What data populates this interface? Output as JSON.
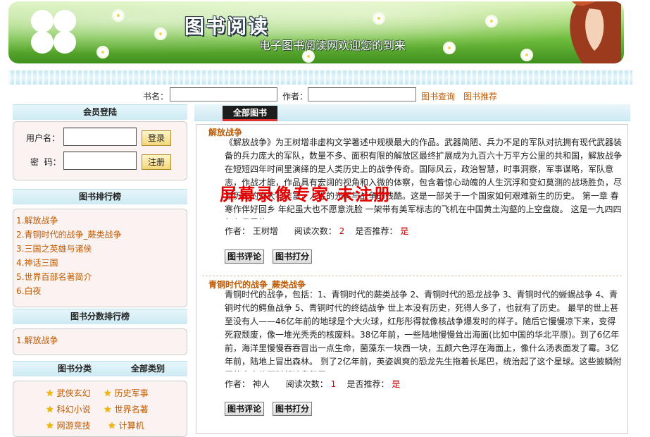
{
  "banner": {
    "title": "图书阅读",
    "subtitle": "电子图书阅读网欢迎您的到来"
  },
  "search": {
    "book_label": "书名：",
    "book_value": "",
    "author_label": "作者：",
    "author_value": "",
    "query_link": "图书查询",
    "recommend_link": "图书推荐"
  },
  "login": {
    "header": "会员登陆",
    "username_label": "用户名：",
    "password_label": "密  码：",
    "username_value": "",
    "password_value": "",
    "login_button": "登录",
    "register_button": "注册"
  },
  "ranking": {
    "header": "图书排行榜",
    "items": [
      "1.解放战争",
      "2.青铜时代的战争_蕨类战争",
      "3.三国之英雄与诸侯",
      "4.神话三国",
      "5.世界百部名著简介",
      "6.白夜"
    ]
  },
  "score_ranking": {
    "header": "图书分数排行榜",
    "items": [
      "1.解放战争"
    ]
  },
  "categories": {
    "header_left": "图书分类",
    "header_right": "全部类别",
    "items": [
      "武侠玄幻",
      "历史军事",
      "科幻小说",
      "世界名著",
      "网游竞技",
      "计算机"
    ]
  },
  "main": {
    "tab": "全部图书",
    "books": [
      {
        "title": "解放战争",
        "description": "《解放战争》为王树增非虚构文学著述中规模最大的作品。武器简陋、兵力不足的军队对抗拥有现代武器装备的兵力庞大的军队，数量不多、面积有限的解放区最终扩展成为九百六十万平方公里的共和国，解放战争在短短四年时间里演绎的是人类历史上的战争传奇。国际风云，政治智慧，时事洞察，军事谋略，军队意志，作战才能，作品具有宏阔的视角和入微的体察，包含着惊心动魄的人生沉浮和变幻莫测的战场胜负，尽显历史的宏大与丰富，人性的光辉与战争的残酷。这是一部关于一个国家如何艰难新生的历史。          第一章 春寒作伴好回乡 年纪虽大也不愿意洗脸            一架带有美军标志的飞机在中国黄土沟壑的上空盘旋。        这是一九四四年七月里的?...",
        "author_label": "作者：",
        "author": "王树增",
        "reads_label": "阅读次数：",
        "reads": "2",
        "recommend_label": "是否推荐：",
        "recommend": "是",
        "review_button": "图书评论",
        "score_button": "图书打分"
      },
      {
        "title": "青铜时代的战争_蕨类战争",
        "description": "青铜时代的战争，包括：1、青铜时代的蕨类战争 2、青铜时代的恐龙战争 3、青铜时代的蜥蜴战争 4、青铜时代的鳄鱼战争 5、青铜时代的终结战争        世上本没有历史，死得人多了，也就有了历史。        最早的世上甚至没有人——46亿年前的地球是个大火球，红彤彤得就像核战争爆发时的样子。随后它慢慢凉下来，变得死寂颓废，像一堆光秃秃的核废料。38亿年前，一些陆地慢慢耸出海面(比如中国的华北平原)。到了6亿年前，海洋里慢慢吞吞冒出一点生命，菌藻东一块西一块，五颜六色浮在海面上，像什么汤表面发了霉。3亿年前，陆地上冒出森林。  到了2亿年前，英姿飒爽的恐龙先生拖着长尾巴，统治起了这个星球。这些披鳞附甲的大家伙不料却被臭氧层?...",
        "author_label": "作者：",
        "author": "神人",
        "reads_label": "阅读次数：",
        "reads": "1",
        "recommend_label": "是否推荐：",
        "recommend": "是",
        "review_button": "图书评论",
        "score_button": "图书打分"
      }
    ]
  },
  "watermark": "屏幕录像专家 未注册"
}
